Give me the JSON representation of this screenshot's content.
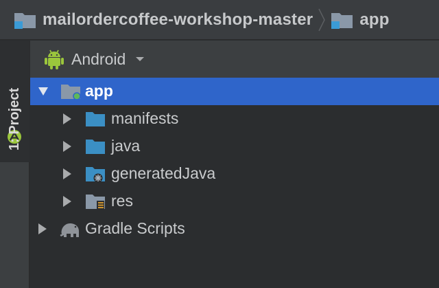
{
  "breadcrumb": {
    "items": [
      {
        "label": "mailordercoffee-workshop-master",
        "icon": "project-folder-icon"
      },
      {
        "label": "app",
        "icon": "module-folder-icon"
      }
    ]
  },
  "tool_window": {
    "tab_label": "1: Project",
    "tab_icon": "android-project-icon"
  },
  "panel": {
    "view_mode": "Android"
  },
  "tree": {
    "root": {
      "label": "app",
      "expanded": true,
      "selected": true
    },
    "children": [
      {
        "label": "manifests",
        "icon": "folder-icon",
        "expanded": false
      },
      {
        "label": "java",
        "icon": "folder-icon",
        "expanded": false
      },
      {
        "label": "generatedJava",
        "icon": "generated-folder-icon",
        "expanded": false
      },
      {
        "label": "res",
        "icon": "resource-folder-icon",
        "expanded": false
      }
    ],
    "gradle": {
      "label": "Gradle Scripts",
      "icon": "gradle-elephant-icon",
      "expanded": false
    }
  },
  "colors": {
    "selection": "#2f65ca",
    "folder_blue": "#3b8fc4",
    "android_green": "#9bc63c",
    "module_dot": "#5fb85a",
    "text": "#c9cbcd"
  }
}
